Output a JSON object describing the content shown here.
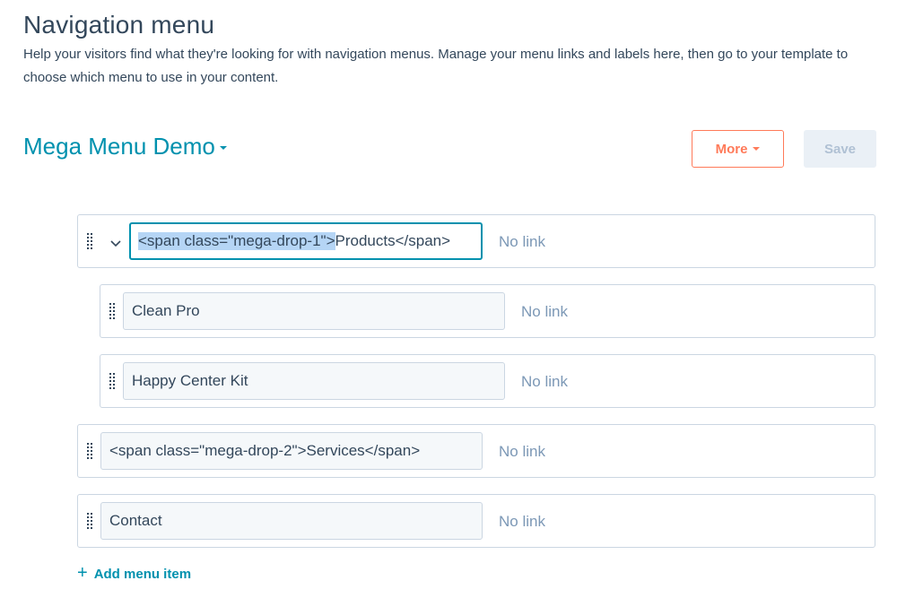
{
  "header": {
    "title": "Navigation menu",
    "description": "Help your visitors find what they're looking for with navigation menus. Manage your menu links and labels here, then go to your template to choose which menu to use in your content."
  },
  "menu": {
    "name": "Mega Menu Demo"
  },
  "toolbar": {
    "more_label": "More",
    "save_label": "Save"
  },
  "items": [
    {
      "label_selected": "<span class=\"mega-drop-1\">",
      "label_rest": "Products</span>",
      "link": "No link"
    },
    {
      "label": "Clean Pro",
      "link": "No link"
    },
    {
      "label": "Happy Center Kit",
      "link": "No link"
    },
    {
      "label": "<span class=\"mega-drop-2\">Services</span>",
      "link": "No link"
    },
    {
      "label": "Contact",
      "link": "No link"
    }
  ],
  "add_item_label": "Add menu item",
  "colors": {
    "accent": "#0091ae",
    "orange": "#ff7a59",
    "text": "#33475b",
    "muted": "#7c98b6",
    "border": "#cbd6e2"
  }
}
